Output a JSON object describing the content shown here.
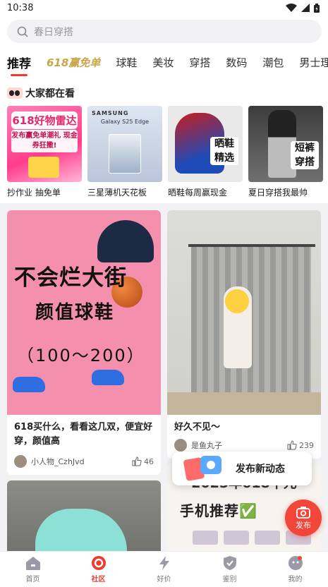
{
  "status": {
    "time": "10:38"
  },
  "search": {
    "placeholder": "春日穿搭"
  },
  "tabs": [
    {
      "label": "推荐",
      "active": true
    },
    {
      "label": "618赢免单",
      "special": true
    },
    {
      "label": "球鞋"
    },
    {
      "label": "美妆"
    },
    {
      "label": "穿搭"
    },
    {
      "label": "数码"
    },
    {
      "label": "潮包"
    },
    {
      "label": "男士理"
    }
  ],
  "hot": {
    "title": "大家都在看",
    "items": [
      {
        "caption": "抄作业 抽免单",
        "img_title": "618好物雷达",
        "img_sub": "发布赢免单潮礼 现金券狂撒!"
      },
      {
        "caption": "三星薄机天花板",
        "img_brand": "SAMSUNG",
        "img_model": "Galaxy S25 Edge"
      },
      {
        "caption": "晒鞋每周赢现金",
        "img_tag": "晒鞋 精选"
      },
      {
        "caption": "夏日穿搭我最帅",
        "img_tag": "短裤 穿搭"
      }
    ]
  },
  "feed": {
    "card1": {
      "img_line1": "不会烂大街",
      "img_line2": "颜值球鞋",
      "img_line3": "（100～200）",
      "title": "618买什么，看看这几双，便宜好穿，颜值高",
      "author": "小人物_CzhJvd",
      "likes": "46"
    },
    "card2": {
      "title": "好久不见～",
      "author": "是鱼丸子",
      "likes": "239"
    },
    "card4": {
      "img_line1": "2025年618千元",
      "img_line2": "手机推荐✅"
    }
  },
  "popup": {
    "label": "发布新动态"
  },
  "fab": {
    "label": "发布"
  },
  "nav": [
    {
      "label": "首页",
      "icon": "home-icon"
    },
    {
      "label": "社区",
      "icon": "community-icon",
      "active": true
    },
    {
      "label": "好价",
      "icon": "lightning-icon"
    },
    {
      "label": "鉴别",
      "icon": "shield-check-icon"
    },
    {
      "label": "我的",
      "icon": "profile-icon",
      "badge": true
    }
  ],
  "colors": {
    "accent": "#ee3b2e",
    "fab": "#f2463a"
  }
}
